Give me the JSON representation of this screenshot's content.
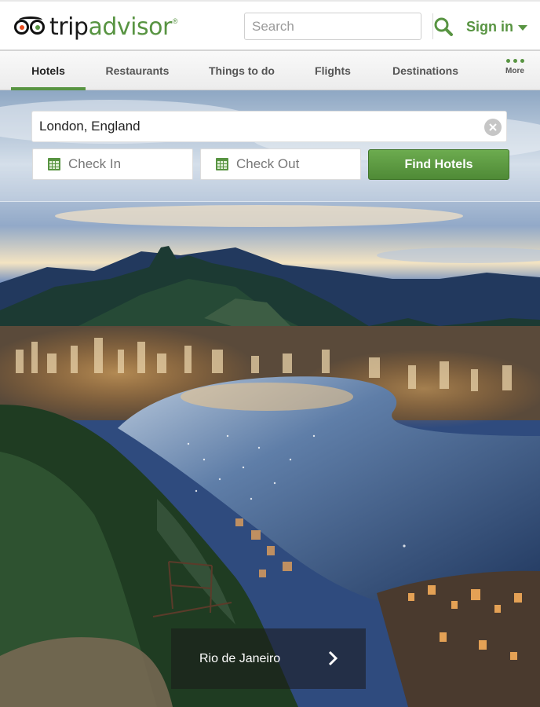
{
  "header": {
    "logo_trip": "trip",
    "logo_advisor": "advisor",
    "logo_reg": "®",
    "search_placeholder": "Search",
    "signin_label": "Sign in"
  },
  "nav": {
    "items": [
      {
        "label": "Hotels",
        "active": true
      },
      {
        "label": "Restaurants",
        "active": false
      },
      {
        "label": "Things to do",
        "active": false
      },
      {
        "label": "Flights",
        "active": false
      },
      {
        "label": "Destinations",
        "active": false
      }
    ],
    "more_label": "More"
  },
  "search_form": {
    "destination_value": "London, England",
    "check_in_label": "Check In",
    "check_out_label": "Check Out",
    "find_button_label": "Find Hotels"
  },
  "hero": {
    "caption": "Rio de Janeiro"
  },
  "colors": {
    "brand_green": "#589442",
    "button_green": "#5e9d43",
    "owl_orange": "#e84c1e"
  },
  "icons": [
    "owl-logo-icon",
    "search-icon",
    "chevron-down-icon",
    "more-dots-icon",
    "clear-icon",
    "calendar-icon",
    "chevron-right-icon"
  ]
}
